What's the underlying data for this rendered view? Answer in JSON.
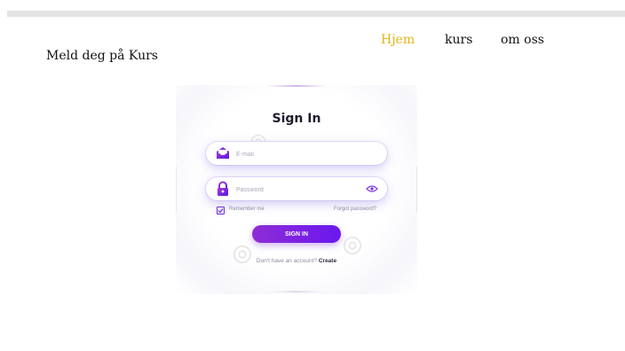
{
  "site": {
    "brand": "Meld deg på Kurs",
    "nav": [
      {
        "label": "Hjem",
        "active": true
      },
      {
        "label": "kurs",
        "active": false
      },
      {
        "label": "om oss",
        "active": false
      }
    ],
    "nav_active_color": "#e1b514"
  },
  "signin": {
    "title": "Sign In",
    "email_placeholder": "E-mail",
    "password_placeholder": "Password",
    "remember_label": "Remember me",
    "remember_checked": true,
    "forgot_label": "Forgot password?",
    "button_label": "SIGN IN",
    "account_prompt": "Don't have an account?",
    "create_label": "Create",
    "accent_start": "#8f2cd6",
    "accent_end": "#6a18ee",
    "icons": {
      "email": "envelope-icon",
      "password": "lock-icon",
      "show_password": "eye-icon",
      "remember": "checkbox-check-icon"
    }
  }
}
